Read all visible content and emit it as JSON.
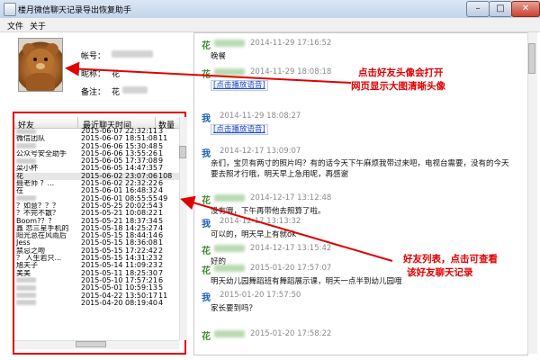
{
  "window": {
    "title": "楼月微信聊天记录导出恢复助手",
    "controls": {
      "minimize": "–",
      "maximize": "□",
      "close": "✕"
    }
  },
  "menu": [
    "文件",
    "关于"
  ],
  "profile": {
    "account_label": "帐号：",
    "nickname_label": "昵称：",
    "nickname_value": "花",
    "remark_label": "备注：",
    "remark_value": "花"
  },
  "friends": {
    "columns": [
      "好友",
      "最近聊天时间",
      "数量"
    ],
    "rows": [
      {
        "name": "",
        "date": "2015-06-07 22:32:11",
        "count": "3"
      },
      {
        "name": "微信团队",
        "date": "2015-06-07 18:51:08",
        "count": "11"
      },
      {
        "name": "",
        "date": "2015-06-06 15:30:48",
        "count": "5"
      },
      {
        "name": "公众号安全助手",
        "date": "2015-06-06 13:55:26",
        "count": "1"
      },
      {
        "name": "",
        "date": "2015-06-05 17:37:08",
        "count": "9"
      },
      {
        "name": "菜小杯",
        "date": "2015-06-05 14:47:35",
        "count": "7"
      },
      {
        "name": "花",
        "date": "2015-06-02 23:07:06",
        "count": "108"
      },
      {
        "name": "聂老师 ？...",
        "date": "2015-06-02 22:32:22",
        "count": "6"
      },
      {
        "name": "在",
        "date": "2015-06-01 16:48:32",
        "count": "4"
      },
      {
        "name": "",
        "date": "2015-06-01 08:55:55",
        "count": "49"
      },
      {
        "name": "？如意？？？",
        "date": "2015-05-25 20:02:54",
        "count": "3"
      },
      {
        "name": "？不完不散？",
        "date": "2015-05-21 10:08:22",
        "count": "1"
      },
      {
        "name": "Boom?？？",
        "date": "2015-05-21 18:37:34",
        "count": "5"
      },
      {
        "name": "鑫 恋三星手机的",
        "date": "2015-05-18 14:25:27",
        "count": "4"
      },
      {
        "name": "阳光总在风雨后",
        "date": "2015-05-15 18:44:14",
        "count": "6"
      },
      {
        "name": "Jess",
        "date": "2015-05-15 18:36:08",
        "count": "1"
      },
      {
        "name": "禁忌之吻",
        "date": "2015-05-15 17:22:42",
        "count": "2"
      },
      {
        "name": "？ 人生若只...",
        "date": "2015-05-15 14:31:23",
        "count": "2"
      },
      {
        "name": "旭夫子",
        "date": "2015-05-14 11:09:23",
        "count": "2"
      },
      {
        "name": "美美",
        "date": "2015-05-11 18:25:30",
        "count": "7"
      },
      {
        "name": "",
        "date": "2015-05-10 17:57:21",
        "count": "6"
      },
      {
        "name": "",
        "date": "2015-05-01 10:59:13",
        "count": "5"
      },
      {
        "name": "",
        "date": "2015-04-22 13:50:17",
        "count": "11"
      },
      {
        "name": "",
        "date": "2015-04-20 08:19:40",
        "count": "4"
      }
    ],
    "selected_index": 6
  },
  "chat": {
    "messages": [
      {
        "sender": "花",
        "time": "2014-11-29 17:16:52",
        "text": "晚餐",
        "link": false
      },
      {
        "sender": "花",
        "time": "2014-11-29 18:08:18",
        "text": "[点击播放语音]",
        "link": true
      },
      {
        "sender": "我",
        "time": "2014-11-29 18:08:27",
        "text": "[点击播放语音]",
        "link": true
      },
      {
        "sender": "我",
        "time": "2014-12-17 13:09:07",
        "text": "亲们，宝贝有两寸的照片吗？有的话今天下午麻烦我带过来吧，电视台需要，没有的今天要去照才行哦，明天早上急用呢，再感谢",
        "link": false
      },
      {
        "sender": "花",
        "time": "2014-12-17 13:12:48",
        "text": "没有哦，下午再带他去照算了啦。",
        "link": false
      },
      {
        "sender": "我",
        "time": "2014-12-17 13:13:32",
        "text": "可以的，明天早上有就ok",
        "link": false
      },
      {
        "sender": "花",
        "time": "2014-12-17 13:15:42",
        "text": "好的",
        "link": false
      },
      {
        "sender": "花",
        "time": "2015-01-20 17:57:07",
        "text": "明天幼儿园舞蹈班有舞蹈展示课，明天一点半到幼儿园哦",
        "link": false
      },
      {
        "sender": "我",
        "time": "2015-01-20 17:57:50",
        "text": "家长要到吗？",
        "link": false
      },
      {
        "sender": "花",
        "time": "2015-01-20 17:58:22",
        "text": "",
        "link": false
      }
    ]
  },
  "annotations": {
    "avatar_note_line1": "点击好友头像会打开",
    "avatar_note_line2": "网页显示大图清晰头像",
    "list_note_line1": "好友列表，点击可查看",
    "list_note_line2": "该好友聊天记录"
  },
  "colors": {
    "annotation": "#e00000",
    "sender_hua": "#3e8e2e",
    "sender_wo": "#1e5fb4",
    "link": "#1f49c7"
  }
}
